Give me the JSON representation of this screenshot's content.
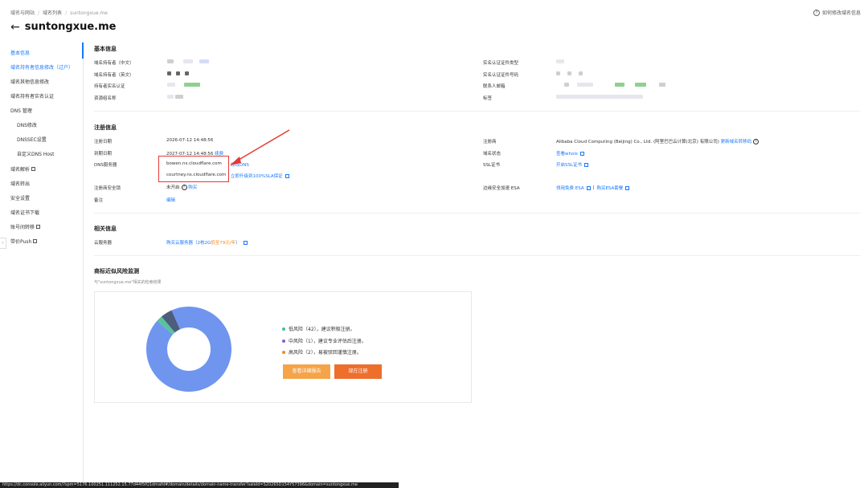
{
  "breadcrumb": [
    "域名与网站",
    "域名列表",
    "suntongxue.me"
  ],
  "help_link": "如何修改域名信息",
  "domain_title": "suntongxue.me",
  "sidebar": {
    "items": [
      {
        "label": "基本信息",
        "active": true
      },
      {
        "label": "域名持有者信息修改（过户）"
      },
      {
        "label": "域名其他信息修改"
      },
      {
        "label": "域名持有者实名认证"
      },
      {
        "label": "DNS 管理"
      },
      {
        "label": "DNS修改"
      },
      {
        "label": "DNSSEC设置"
      },
      {
        "label": "自定义DNS Host"
      },
      {
        "label": "域名解析"
      },
      {
        "label": "域名转出"
      },
      {
        "label": "安全设置"
      },
      {
        "label": "域名证书下载"
      },
      {
        "label": "账号间转移"
      },
      {
        "label": "带价Push"
      }
    ],
    "collapse_glyph": "›"
  },
  "basic": {
    "title": "基本信息",
    "left_labels": [
      "域名持有者（中文）",
      "域名持有者（英文）",
      "持有者实名认证",
      "资源组名称"
    ],
    "right_labels": [
      "实名认证证件类型",
      "实名认证证件号码",
      "联系人邮箱",
      "标签"
    ]
  },
  "registration": {
    "title": "注册信息",
    "reg_date_label": "注册日期",
    "reg_date": "2026-07-12 14:48:56",
    "expire_label": "到期日期",
    "expire_date": "2027-07-12 14:48:56",
    "renew": "续费",
    "dns_label": "DNS服务器",
    "dns1": "bowen.ns.cloudflare.com",
    "dns2": "courtney.ns.cloudflare.com",
    "modify_dns": "修改DNS",
    "upgrade_sla": "立即升级到100%SLA保证",
    "lock_label": "注册商安全锁",
    "lock_value": "未开启",
    "buy": "购买",
    "remark_label": "备注",
    "edit": "编辑",
    "registrar_label": "注册商",
    "registrar_value": "Alibaba Cloud Computing (Beijing) Co., Ltd. (阿里巴巴云计算(北京) 有限公司)",
    "transfer": "更新域名转移码",
    "status_label": "域名状态",
    "whois": "查看whois",
    "ssl_label": "SSL证书",
    "ssl_link": "开启SSL证书",
    "esa_label": "边缘安全加速 ESA",
    "esa_free": "领用免费 ESA",
    "esa_sep": "|",
    "esa_buy": "购买ESA套餐"
  },
  "related": {
    "title": "相关信息",
    "cloud_label": "云服务器",
    "cloud_link": "购买云服务器（2核2G",
    "cloud_price": "低至79元/年",
    "cloud_end": "）"
  },
  "risk": {
    "title": "商标近似风险监测",
    "subtitle": "与\"suntongxue.me\"相关的检索结果",
    "legend": [
      {
        "label": "低风险（42），建议积极注册。",
        "color": "#3cc29a"
      },
      {
        "label": "中风险（1），建议专业评估后注册。",
        "color": "#8e5ad8"
      },
      {
        "label": "高风险（2），易被驳回谨慎注册。",
        "color": "#f08a24"
      }
    ],
    "pie": [
      {
        "value": 42,
        "color": "#6f95ef"
      },
      {
        "value": 1,
        "color": "#56c59a"
      },
      {
        "value": 2,
        "color": "#4d5d7c"
      }
    ],
    "btn_report": "查看详细报告",
    "btn_register": "现在注册",
    "report_color": "#f5a44a",
    "register_color": "#ee6e2c"
  },
  "statusbar_url": "https://dc.console.aliyun.com/?spm=5176.100251.111252.15.77d44f5fQ1dmafd#/domain/details/domain-name-transfer?saleId=S20265D154Y57396&domain=suntongxue.me"
}
